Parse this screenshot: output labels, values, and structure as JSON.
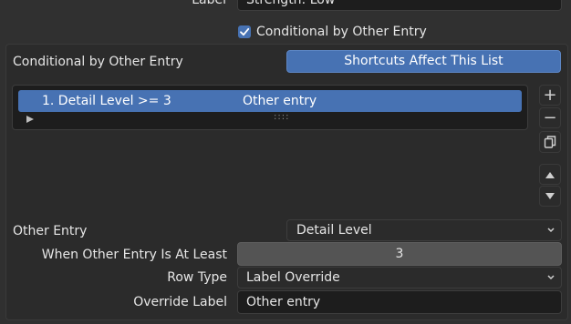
{
  "top": {
    "label_text": "Label",
    "label_value": "Strength: Low",
    "conditional_checkbox_label": "Conditional by Other Entry",
    "conditional_checked": true
  },
  "panel": {
    "title": "Conditional by Other Entry",
    "shortcuts_button": "Shortcuts Affect This List",
    "list": {
      "items": [
        {
          "name": "1. Detail Level >= 3",
          "other": "Other entry"
        }
      ],
      "grip": "::::"
    },
    "side_buttons": {
      "add": "+",
      "remove": "−"
    },
    "other_entry_label": "Other Entry",
    "other_entry_value": "Detail Level",
    "when_label": "When Other Entry Is At Least",
    "when_value": "3",
    "row_type_label": "Row Type",
    "row_type_value": "Label Override",
    "override_label_label": "Override Label",
    "override_label_value": "Other entry"
  },
  "colors": {
    "accent": "#4772b3",
    "background": "#303030",
    "field": "#1d1d1d",
    "number_field": "#545454"
  }
}
